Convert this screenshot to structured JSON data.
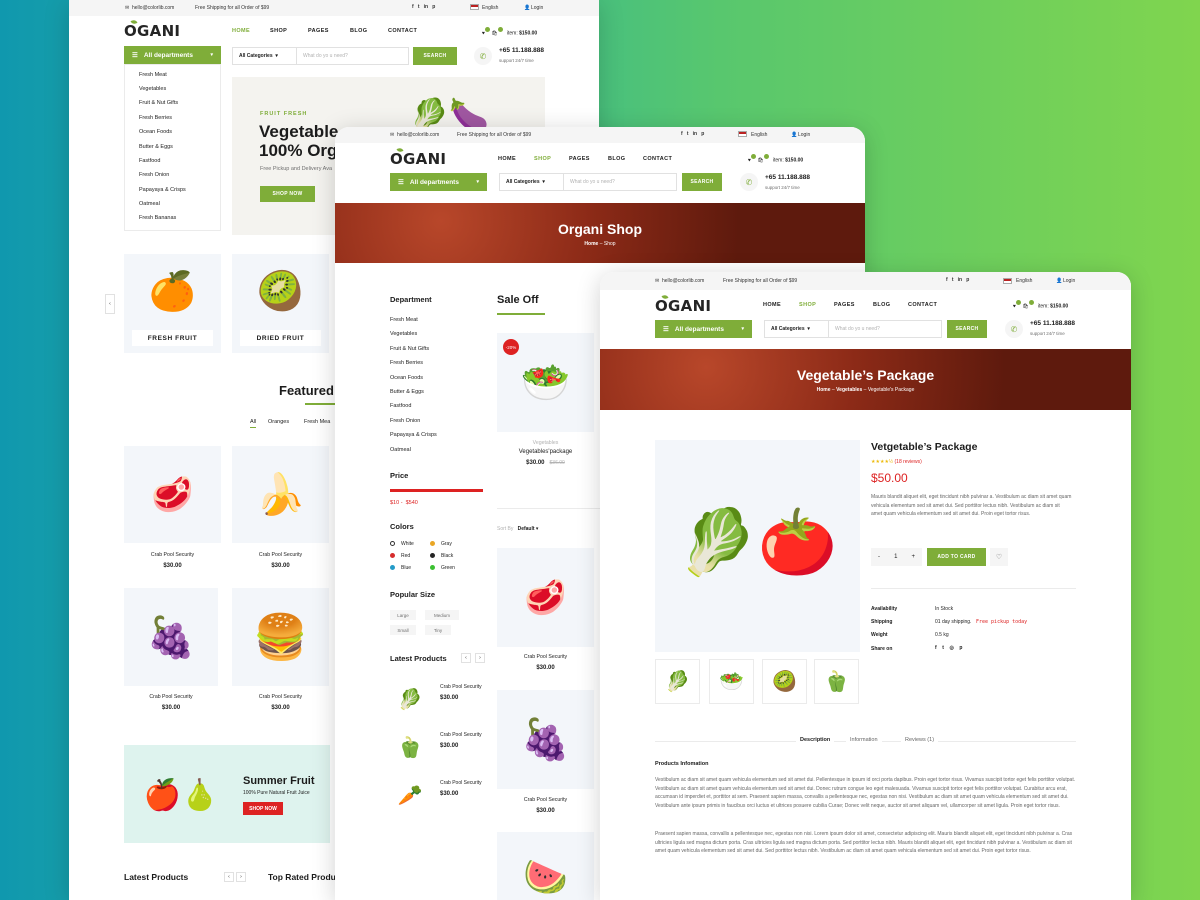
{
  "w1": {
    "email": "hello@colorlib.com",
    "shipping": "Free Shipping for all Order of $99",
    "language": "English",
    "login": "Login",
    "logo": "OGANI",
    "nav": [
      "HOME",
      "SHOP",
      "PAGES",
      "BLOG",
      "CONTACT"
    ],
    "cart_item_label": "item:",
    "cart_total": "$150.00",
    "departments_label": "All departments",
    "departments": [
      "Fresh Meat",
      "Vegetables",
      "Fruit & Nut Gifts",
      "Fresh Berries",
      "Ocean Foods",
      "Butter & Eggs",
      "Fastfood",
      "Fresh Onion",
      "Papayaya & Crisps",
      "Oatmeal",
      "Fresh Bananas"
    ],
    "search_category": "All Categories",
    "search_placeholder": "What do yo u need?",
    "search_button": "SEARCH",
    "phone": "+65 11.188.888",
    "support": "support 24/7 time",
    "hero_kicker": "FRUIT FRESH",
    "hero_title_1": "Vegetable",
    "hero_title_2": "100% Org",
    "hero_sub": "Free Pickup and Delivery Ava",
    "hero_button": "SHOP NOW",
    "categories": [
      "FRESH FRUIT",
      "DRIED FRUIT"
    ],
    "featured_title": "Featured",
    "filters": [
      "All",
      "Oranges",
      "Fresh Mea"
    ],
    "products": [
      {
        "name": "Crab Pool Security",
        "price": "$30.00",
        "icon": "meat"
      },
      {
        "name": "Crab Pool Security",
        "price": "$30.00",
        "icon": "banana"
      },
      {
        "name": "Crab Pool Security",
        "price": "$30.00",
        "icon": "grapes"
      },
      {
        "name": "Crab Pool Security",
        "price": "$30.00",
        "icon": "burger"
      }
    ],
    "banner_title": "Summer Fruit",
    "banner_sub": "100% Pure Natural Fruit Juice",
    "banner_button": "SHOP NOW",
    "latest_title": "Latest Products",
    "top_rated_title": "Top Rated Produ"
  },
  "w2": {
    "email": "hello@colorlib.com",
    "shipping": "Free Shipping for all Order of $99",
    "language": "English",
    "login": "Login",
    "logo": "OGANI",
    "nav": [
      "HOME",
      "SHOP",
      "PAGES",
      "BLOG",
      "CONTACT"
    ],
    "cart_item_label": "item:",
    "cart_total": "$150.00",
    "departments_label": "All departments",
    "search_category": "All Categories",
    "search_placeholder": "What do yo u need?",
    "search_button": "SEARCH",
    "phone": "+65 11.188.888",
    "support": "support 24/7 time",
    "hero_title": "Organi Shop",
    "crumb_home": "Home",
    "crumb_current": "Shop",
    "department_title": "Department",
    "departments": [
      "Fresh Meat",
      "Vegetables",
      "Fruit & Nut Gifts",
      "Fresh Berries",
      "Ocean Foods",
      "Butter & Eggs",
      "Fastfood",
      "Fresh Onion",
      "Papayaya & Crisps",
      "Oatmeal"
    ],
    "price_title": "Price",
    "price_min": "$10",
    "price_max": "$540",
    "colors_title": "Colors",
    "colors": [
      {
        "name": "White",
        "color": "#ffffff"
      },
      {
        "name": "Gray",
        "color": "#e9a625"
      },
      {
        "name": "Red",
        "color": "#d62d2d"
      },
      {
        "name": "Black",
        "color": "#252525"
      },
      {
        "name": "Blue",
        "color": "#249bc8"
      },
      {
        "name": "Green",
        "color": "#3cc032"
      }
    ],
    "size_title": "Popular Size",
    "sizes": [
      "Large",
      "Medium",
      "Small",
      "Tiny"
    ],
    "latest_title": "Latest Products",
    "latest": [
      {
        "name": "Crab Pool Security",
        "price": "$30.00"
      },
      {
        "name": "Crab Pool Security",
        "price": "$30.00"
      },
      {
        "name": "Crab Pool Security",
        "price": "$30.00"
      }
    ],
    "sale_title": "Sale Off",
    "sale_badge": "-20%",
    "sale_category": "Vegetables",
    "sale_name": "Vegetables'package",
    "sale_price": "$30.00",
    "sale_old": "$36.00",
    "sort_label": "Sort By",
    "sort_value": "Default",
    "grid": [
      {
        "name": "Crab Pool Security",
        "price": "$30.00"
      },
      {
        "name": "Crab Pool Security",
        "price": "$30.00"
      }
    ]
  },
  "w3": {
    "email": "hello@colorlib.com",
    "shipping": "Free Shipping for all Order of $99",
    "language": "English",
    "login": "Login",
    "logo": "OGANI",
    "nav": [
      "HOME",
      "SHOP",
      "PAGES",
      "BLOG",
      "CONTACT"
    ],
    "cart_item_label": "item:",
    "cart_total": "$150.00",
    "departments_label": "All departments",
    "search_category": "All Categories",
    "search_placeholder": "What do yo u need?",
    "search_button": "SEARCH",
    "phone": "+65 11.188.888",
    "support": "support 24/7 time",
    "hero_title": "Vegetable’s Package",
    "crumb_home": "Home",
    "crumb_mid": "Vegetables",
    "crumb_current": "Vegetable's Package",
    "product_title": "Vetgetable’s Package",
    "rating": 4.5,
    "reviews": "(18 reviews)",
    "price": "$50.00",
    "description": "Mauris blandit aliquet elit, eget tincidunt nibh pulvinar a. Vestibulum ac diam sit amet quam vehicula elementum sed sit amet dui. Sed porttitor lectus nibh. Vestibulum ac diam sit amet quam vehicula elementum sed sit amet dui. Proin eget tortor risus.",
    "qty": "1",
    "add_to_cart": "ADD TO CARD",
    "specs": [
      {
        "label": "Availability",
        "value": "In Stock"
      },
      {
        "label": "Shipping",
        "value": "01 day shipping.",
        "note": "Free pickup today"
      },
      {
        "label": "Weight",
        "value": "0.5 kg"
      },
      {
        "label": "Share on",
        "value": ""
      }
    ],
    "tabs": [
      "Description",
      "Information",
      "Reviews (1)"
    ],
    "info_title": "Products Infomation",
    "para1": "Vestibulum ac diam sit amet quam vehicula elementum sed sit amet dui. Pellentesque in ipsum id orci porta dapibus. Proin eget tortor risus. Vivamus suscipit tortor eget felis porttitor volutpat. Vestibulum ac diam sit amet quam vehicula elementum sed sit amet dui. Donec rutrum congue leo eget malesuada. Vivamus suscipit tortor eget felis porttitor volutpat. Curabitur arcu erat, accumsan id imperdiet et, porttitor at sem. Praesent sapien massa, convallis a pellentesque nec, egestas non nisi. Vestibulum ac diam sit amet quam vehicula elementum sed sit amet dui. Vestibulum ante ipsum primis in faucibus orci luctus et ultrices posuere cubilia Curae; Donec velit neque, auctor sit amet aliquam vel, ullamcorper sit amet ligula. Proin eget tortor risus.",
    "para2": "Praesent sapien massa, convallis a pellentesque nec, egestas non nisi. Lorem ipsum dolor sit amet, consectetur adipiscing elit. Mauris blandit aliquet elit, eget tincidunt nibh pulvinar a. Cras ultricies ligula sed magna dictum porta. Cras ultricies ligula sed magna dictum porta. Sed porttitor lectus nibh. Mauris blandit aliquet elit, eget tincidunt nibh pulvinar a. Vestibulum ac diam sit amet quam vehicula elementum sed sit amet dui. Sed porttitor lectus nibh. Vestibulum ac diam sit amet quam vehicula elementum sed sit amet dui. Proin eget tortor risus."
  },
  "colors": {
    "accent": "#7fad39",
    "sale": "#dd2222"
  }
}
